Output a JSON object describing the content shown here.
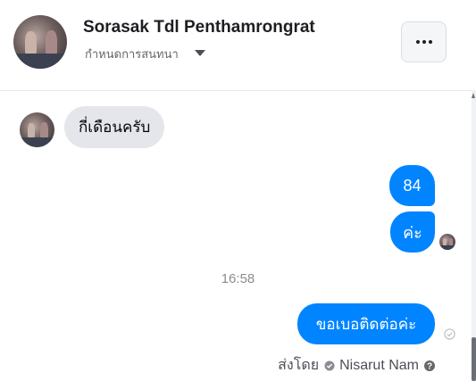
{
  "header": {
    "contact_name": "Sorasak Tdl Penthamrongrat",
    "subtitle": "กำหนดการสนทนา",
    "more_button_icon": "ellipsis-icon"
  },
  "messages": {
    "incoming_1": "กี่เดือนครับ",
    "outgoing_1": "84",
    "outgoing_2": "ค่ะ",
    "timestamp": "16:58",
    "outgoing_3": "ขอเบอติดต่อค่ะ"
  },
  "sent_by": {
    "label": "ส่งโดย",
    "name": "Nisarut Nam"
  },
  "colors": {
    "outgoing_bubble": "#0084ff",
    "incoming_bubble": "#e4e6eb"
  }
}
